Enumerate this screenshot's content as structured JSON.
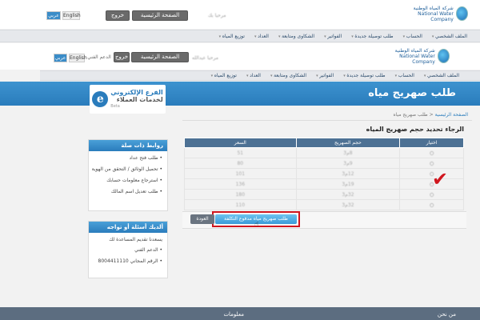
{
  "header1": {
    "logo_ar": "شركة المياه الوطنية",
    "logo_en": "National Water Company",
    "greeting": "مرحبا بك",
    "lang_en": "English",
    "lang_ar": "عربي",
    "home_button": "الصفحة الرئيسية",
    "logout_button": "خروج"
  },
  "header2": {
    "logo_ar": "شركة المياه الوطنية",
    "logo_en": "National Water Company",
    "greeting": "مرحبا عبدالله",
    "lang_en": "English",
    "lang_ar": "عربي",
    "support": "الدعم الفني",
    "home_button": "الصفحة الرئيسية",
    "logout_button": "خروج"
  },
  "nav": [
    "الملف الشخصي",
    "الحساب",
    "طلب توصيلة جديدة",
    "الفواتير",
    "الشكاوى ومتابعة",
    "العداد",
    "توزيع المياه"
  ],
  "banner": {
    "title": "طلب صهريج مياه",
    "eb_line1": "الفرع الإلكتروني",
    "eb_line2": "لخدمات العملاء",
    "eb_beta": "Beta"
  },
  "breadcrumb": {
    "home": "الصفحة الرئيسية",
    "sep": "<",
    "current": "طلب صهريج مياه"
  },
  "main": {
    "heading": "الرجاء تحديد حجم صهريج المياه",
    "columns": [
      "اختيار",
      "حجم الصهريج",
      "السعر"
    ],
    "rows": [
      [
        "○",
        "8م3",
        "51"
      ],
      [
        "○",
        "9م3",
        "80"
      ],
      [
        "○",
        "12م3",
        "101"
      ],
      [
        "○",
        "19م3",
        "136"
      ],
      [
        "○",
        "32م3",
        "180"
      ],
      [
        "○",
        "32م3",
        "110"
      ]
    ],
    "submit_button": "طلب صهريج مياه مدفوع التكلفة",
    "back_button": "العودة"
  },
  "links_panel": {
    "title": "روابط ذات صلة",
    "items": [
      "طلب فتح عداد",
      "تحميل الوثائق / التحقق من الهوية",
      "استرجاع معلومات حسابك",
      "طلب تعديل اسم المالك"
    ]
  },
  "help_panel": {
    "title": "ألديك أسئلة أو تواجه مشاكل؟",
    "subtitle": "يسعدنا تقديم المساعدة لك",
    "items": [
      "الدعم الفني",
      "الرقم المجاني 8004411110"
    ]
  },
  "footer": {
    "about": "من نحن",
    "info": "معلومات"
  },
  "colors": {
    "accent": "#2a7cbc",
    "annotation": "#d0161e"
  },
  "annotation_mark": "✔"
}
